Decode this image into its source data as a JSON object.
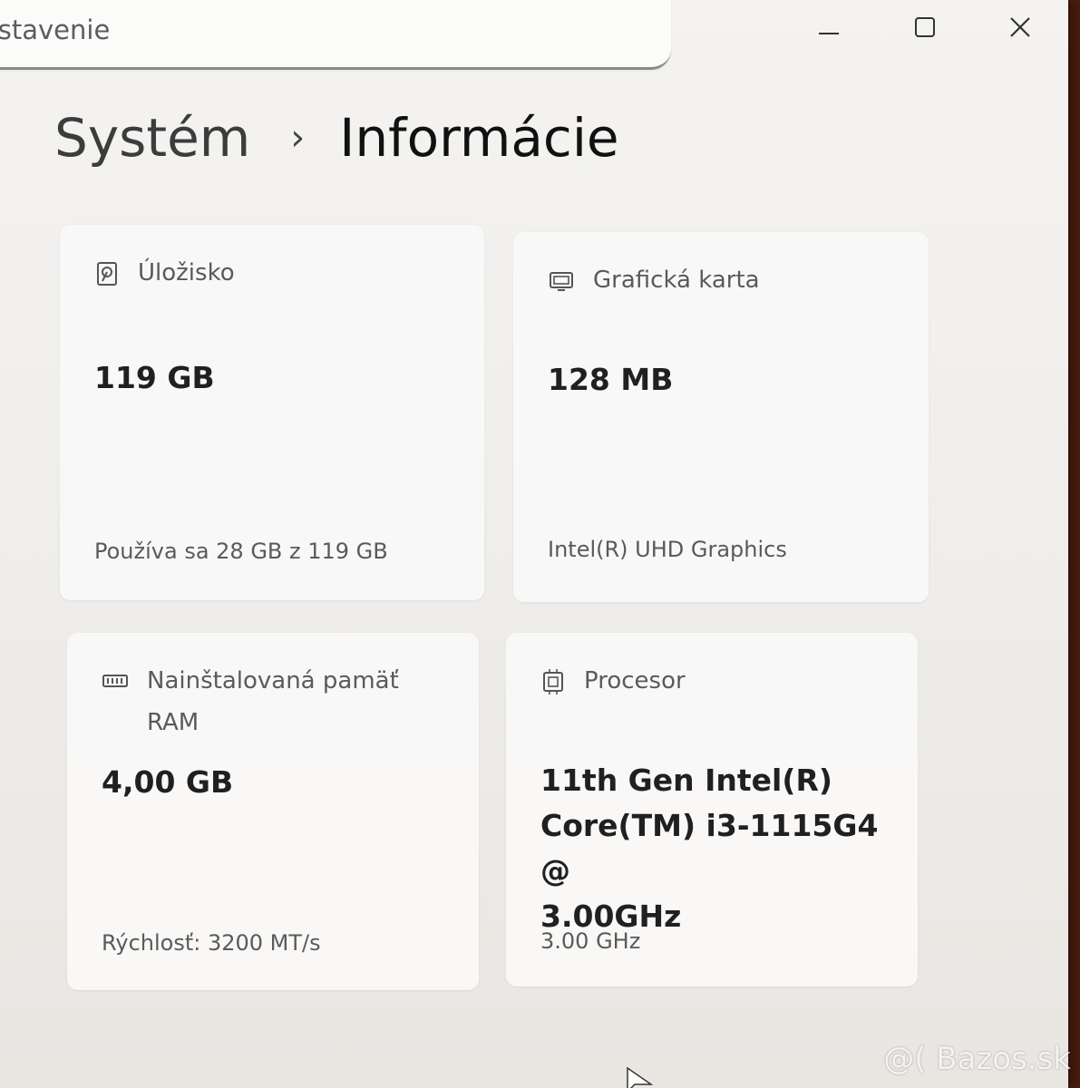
{
  "search": {
    "value": "astavenie"
  },
  "window_controls": {
    "minimize": "minimize",
    "maximize": "maximize",
    "close": "close"
  },
  "breadcrumb": {
    "parent": "Systém",
    "separator": "›",
    "current": "Informácie"
  },
  "cards": {
    "storage": {
      "icon": "hard-drive-icon",
      "label": "Úložisko",
      "value": "119 GB",
      "sub": "Používa sa 28 GB z 119 GB"
    },
    "graphics": {
      "icon": "monitor-icon",
      "label": "Grafická karta",
      "value": "128 MB",
      "sub": "Intel(R) UHD Graphics"
    },
    "ram": {
      "icon": "memory-icon",
      "label_line1": "Nainštalovaná pamäť",
      "label_line2": "RAM",
      "value": "4,00 GB",
      "sub": "Rýchlosť: 3200 MT/s"
    },
    "cpu": {
      "icon": "cpu-chip-icon",
      "label": "Procesor",
      "value_line1": "11th Gen Intel(R)",
      "value_line2": "Core(TM) i3-1115G4 @",
      "value_line3": "3.00GHz",
      "sub": "3.00 GHz"
    }
  },
  "watermark": "@( Bazos.sk"
}
